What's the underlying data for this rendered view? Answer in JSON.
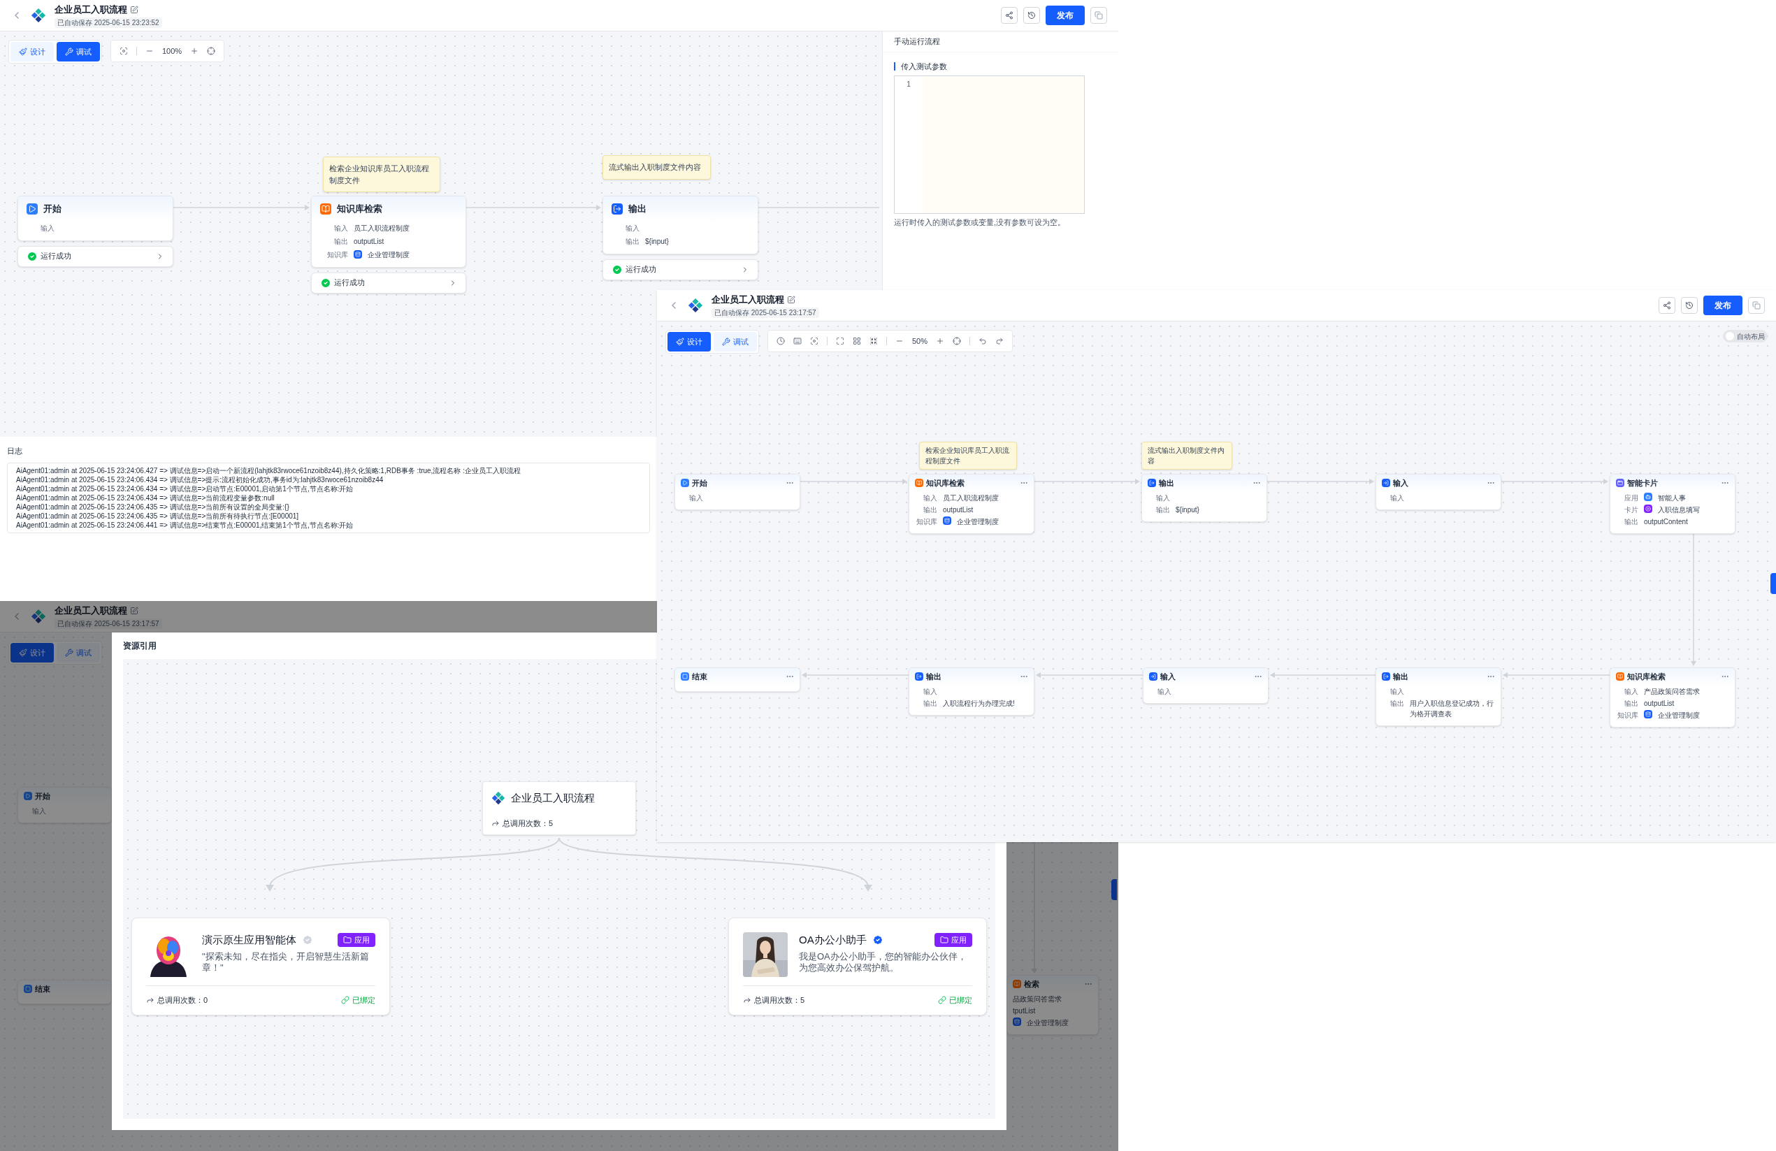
{
  "debug_window": {
    "header": {
      "title": "企业员工入职流程",
      "saved": "已自动保存 2025-06-15 23:23:52",
      "publish": "发布"
    },
    "mode_tabs": [
      {
        "label": "设计",
        "selected": false
      },
      {
        "label": "调试",
        "selected": true
      }
    ],
    "zoom": "100%",
    "notes": [
      "检索企业知识库员工入职流程制度文件",
      "流式输出入职制度文件内容"
    ],
    "nodes": [
      {
        "kind": "start",
        "title": "开始",
        "rows": [
          {
            "kind": "field",
            "label": "输入"
          }
        ],
        "status": "运行成功"
      },
      {
        "kind": "knowledge",
        "title": "知识库检索",
        "rows": [
          {
            "kind": "field",
            "label": "输入",
            "value": "员工入职流程制度"
          },
          {
            "kind": "field",
            "label": "输出",
            "value": "outputList"
          },
          {
            "kind": "knowledge_base",
            "label": "知识库",
            "value": "企业管理制度"
          }
        ],
        "status": "运行成功"
      },
      {
        "kind": "output",
        "title": "输出",
        "rows": [
          {
            "kind": "field",
            "label": "输入"
          },
          {
            "kind": "field",
            "label": "输出",
            "value": "${input}"
          }
        ],
        "status": "运行成功"
      }
    ],
    "run_panel": {
      "title": "手动运行流程",
      "section": "传入测试参数",
      "line_number": "1",
      "hint": "运行时传入的测试参数或变量,没有参数可设为空。"
    },
    "log": {
      "title": "日志",
      "lines": [
        "AiAgent01:admin at 2025-06-15 23:24:06.427 => 调试信息=>启动一个新流程(lahjtk83rwoce61nzoib8z44),持久化策略:1,RDB事务 :true,流程名称 :企业员工入职流程",
        "AiAgent01:admin at 2025-06-15 23:24:06.434 => 调试信息=>提示:流程初始化成功,事务id为:lahjtk83rwoce61nzoib8z44",
        "AiAgent01:admin at 2025-06-15 23:24:06.434 => 调试信息=>启动节点:E00001,启动第1个节点,节点名称:开始",
        "AiAgent01:admin at 2025-06-15 23:24:06.434 => 调试信息=>当前流程变量参数:null",
        "AiAgent01:admin at 2025-06-15 23:24:06.435 => 调试信息=>当前所有设置的全局变量:{}",
        "AiAgent01:admin at 2025-06-15 23:24:06.435 => 调试信息=>当前所有待执行节点:[E00001]",
        "AiAgent01:admin at 2025-06-15 23:24:06.441 => 调试信息=>结束节点:E00001,结束第1个节点,节点名称:开始"
      ]
    }
  },
  "design_window": {
    "header": {
      "title": "企业员工入职流程",
      "saved": "已自动保存 2025-06-15 23:17:57",
      "publish": "发布"
    },
    "mode_tabs": [
      {
        "label": "设计",
        "selected": true
      },
      {
        "label": "调试",
        "selected": false
      }
    ],
    "zoom": "50%",
    "auto_layout": {
      "label": "自动布局",
      "on": false
    },
    "notes": [
      "检索企业知识库员工入职流程制度文件",
      "流式输出入职制度文件内容"
    ],
    "nodes": [
      {
        "kind": "start",
        "title": "开始",
        "rows": [
          {
            "kind": "field",
            "label": "输入"
          }
        ]
      },
      {
        "kind": "knowledge",
        "title": "知识库检索",
        "rows": [
          {
            "kind": "field",
            "label": "输入",
            "value": "员工入职流程制度"
          },
          {
            "kind": "field",
            "label": "输出",
            "value": "outputList"
          },
          {
            "kind": "knowledge_base",
            "label": "知识库",
            "value": "企业管理制度"
          }
        ]
      },
      {
        "kind": "output",
        "title": "输出",
        "rows": [
          {
            "kind": "field",
            "label": "输入"
          },
          {
            "kind": "field",
            "label": "输出",
            "value": "${input}"
          }
        ]
      },
      {
        "kind": "input",
        "title": "输入",
        "rows": [
          {
            "kind": "field",
            "label": "输入"
          }
        ]
      },
      {
        "kind": "card",
        "title": "智能卡片",
        "rows": [
          {
            "kind": "app",
            "label": "应用",
            "value": "智能人事"
          },
          {
            "kind": "card",
            "label": "卡片",
            "value": "入职信息填写"
          },
          {
            "kind": "field",
            "label": "输出",
            "value": "outputContent"
          }
        ]
      },
      {
        "kind": "end",
        "title": "结束"
      },
      {
        "kind": "output",
        "title": "输出",
        "rows": [
          {
            "kind": "field",
            "label": "输入"
          },
          {
            "kind": "field",
            "label": "输出",
            "value": "入职流程行为办理完成!"
          }
        ]
      },
      {
        "kind": "input",
        "title": "输入",
        "rows": [
          {
            "kind": "field",
            "label": "输入"
          }
        ]
      },
      {
        "kind": "output",
        "title": "输出",
        "rows": [
          {
            "kind": "field",
            "label": "输入"
          },
          {
            "kind": "field",
            "label": "输出",
            "value": "用户入职信息登记成功，行为格开调查表"
          }
        ]
      },
      {
        "kind": "knowledge",
        "title": "知识库检索",
        "rows": [
          {
            "kind": "field",
            "label": "输入",
            "value": "产品政策问答需求"
          },
          {
            "kind": "field",
            "label": "输出",
            "value": "outputList"
          },
          {
            "kind": "knowledge_base",
            "label": "知识库",
            "value": "企业管理制度"
          }
        ]
      }
    ]
  },
  "reference_window": {
    "header": {
      "title": "企业员工入职流程",
      "saved": "已自动保存 2025-06-15 23:17:57"
    },
    "mode_tabs": [
      {
        "label": "设计",
        "selected": true
      },
      {
        "label": "调试",
        "selected": false
      }
    ],
    "nodes": [
      {
        "kind": "start",
        "title": "开始",
        "rows": [
          {
            "kind": "field",
            "label": "输入"
          }
        ]
      },
      {
        "kind": "end",
        "title": "结束"
      },
      {
        "kind": "knowledge",
        "title": "检索",
        "rows": [
          {
            "kind": "field",
            "value": "品政策问答需求"
          },
          {
            "kind": "field",
            "value": "tputList"
          },
          {
            "kind": "knowledge_base",
            "value": "企业管理制度"
          }
        ]
      }
    ],
    "dialog": {
      "title": "资源引用",
      "workflow": {
        "name": "企业员工入职流程",
        "calls": "总调用次数：5"
      },
      "references": [
        {
          "name": "演示原生应用智能体",
          "verified": false,
          "tag": "应用",
          "description": "\"探索未知，尽在指尖，开启智慧生活新篇章！\"",
          "calls": "总调用次数：0",
          "bound": "已绑定"
        },
        {
          "name": "OA办公小助手",
          "verified": true,
          "tag": "应用",
          "description": "我是OA办公小助手，您的智能办公伙伴，为您高效办公保驾护航。",
          "calls": "总调用次数：5",
          "bound": "已绑定"
        }
      ]
    }
  }
}
